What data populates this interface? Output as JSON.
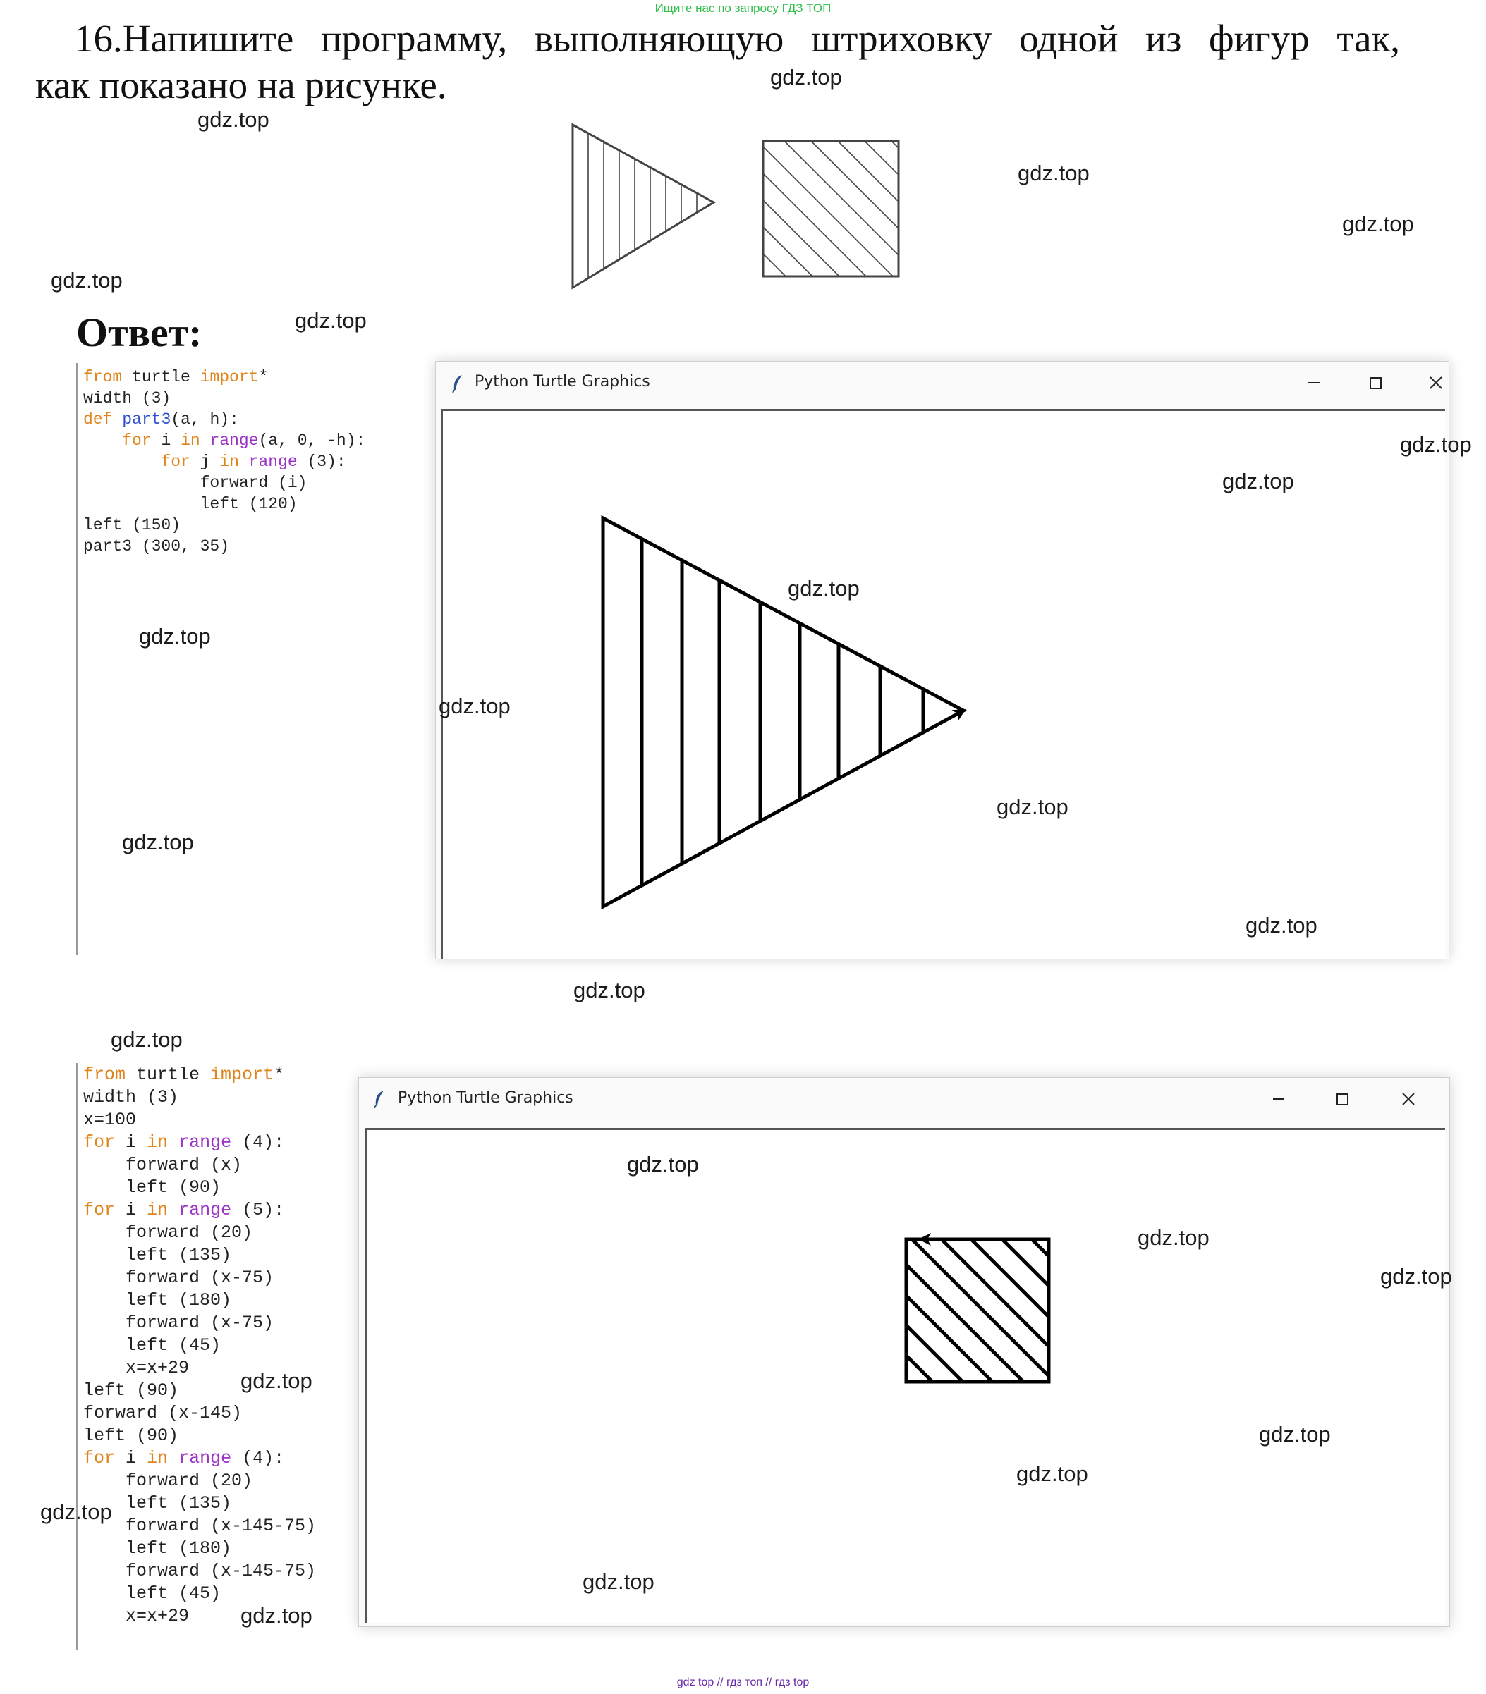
{
  "banner": "Ищите нас по запросу ГДЗ ТОП",
  "task": {
    "line1": "16.Напишите программу, выполняющую штриховку одной из фигур так,",
    "line2": "как показано на рисунке."
  },
  "answer_label": "Ответ:",
  "watermark": "gdz.top",
  "footer": "gdz top  //  гдз топ  //  гдз top",
  "window1": {
    "title": "Python Turtle Graphics",
    "code": [
      [
        [
          "kw",
          "from"
        ],
        [
          "t",
          " turtle "
        ],
        [
          "kw",
          "import"
        ],
        [
          "t",
          "*"
        ]
      ],
      [
        [
          "t",
          "width (3)"
        ]
      ],
      [
        [
          "kw",
          "def"
        ],
        [
          "t",
          " "
        ],
        [
          "fn",
          "part3"
        ],
        [
          "t",
          "(a, h):"
        ]
      ],
      [
        [
          "t",
          "    "
        ],
        [
          "kw",
          "for"
        ],
        [
          "t",
          " i "
        ],
        [
          "kw",
          "in"
        ],
        [
          "t",
          " "
        ],
        [
          "bi",
          "range"
        ],
        [
          "t",
          "(a, 0, -h):"
        ]
      ],
      [
        [
          "t",
          "        "
        ],
        [
          "kw",
          "for"
        ],
        [
          "t",
          " j "
        ],
        [
          "kw",
          "in"
        ],
        [
          "t",
          " "
        ],
        [
          "bi",
          "range"
        ],
        [
          "t",
          " (3):"
        ]
      ],
      [
        [
          "t",
          "            forward (i)"
        ]
      ],
      [
        [
          "t",
          "            left (120)"
        ]
      ],
      [
        [
          "t",
          "left (150)"
        ]
      ],
      [
        [
          "t",
          "part3 (300, 35)"
        ]
      ]
    ]
  },
  "window2": {
    "title": "Python Turtle Graphics",
    "code": [
      [
        [
          "kw",
          "from"
        ],
        [
          "t",
          " turtle "
        ],
        [
          "kw",
          "import"
        ],
        [
          "t",
          "*"
        ]
      ],
      [
        [
          "t",
          "width (3)"
        ]
      ],
      [
        [
          "t",
          "x=100"
        ]
      ],
      [
        [
          "kw",
          "for"
        ],
        [
          "t",
          " i "
        ],
        [
          "kw",
          "in"
        ],
        [
          "t",
          " "
        ],
        [
          "bi",
          "range"
        ],
        [
          "t",
          " (4):"
        ]
      ],
      [
        [
          "t",
          "    forward (x)"
        ]
      ],
      [
        [
          "t",
          "    left (90)"
        ]
      ],
      [
        [
          "kw",
          "for"
        ],
        [
          "t",
          " i "
        ],
        [
          "kw",
          "in"
        ],
        [
          "t",
          " "
        ],
        [
          "bi",
          "range"
        ],
        [
          "t",
          " (5):"
        ]
      ],
      [
        [
          "t",
          "    forward (20)"
        ]
      ],
      [
        [
          "t",
          "    left (135)"
        ]
      ],
      [
        [
          "t",
          "    forward (x-75)"
        ]
      ],
      [
        [
          "t",
          "    left (180)"
        ]
      ],
      [
        [
          "t",
          "    forward (x-75)"
        ]
      ],
      [
        [
          "t",
          "    left (45)"
        ]
      ],
      [
        [
          "t",
          "    x=x+29"
        ]
      ],
      [
        [
          "t",
          "left (90)"
        ]
      ],
      [
        [
          "t",
          "forward (x-145)"
        ]
      ],
      [
        [
          "t",
          "left (90)"
        ]
      ],
      [
        [
          "kw",
          "for"
        ],
        [
          "t",
          " i "
        ],
        [
          "kw",
          "in"
        ],
        [
          "t",
          " "
        ],
        [
          "bi",
          "range"
        ],
        [
          "t",
          " (4):"
        ]
      ],
      [
        [
          "t",
          "    forward (20)"
        ]
      ],
      [
        [
          "t",
          "    left (135)"
        ]
      ],
      [
        [
          "t",
          "    forward (x-145-75)"
        ]
      ],
      [
        [
          "t",
          "    left (180)"
        ]
      ],
      [
        [
          "t",
          "    forward (x-145-75)"
        ]
      ],
      [
        [
          "t",
          "    left (45)"
        ]
      ],
      [
        [
          "t",
          "    x=x+29"
        ]
      ]
    ]
  },
  "colors": {
    "keyword": "#e0841a",
    "builtin": "#9a33c6",
    "function": "#2d4fd0",
    "banner": "#2fbf4a",
    "footer": "#6a2aa8"
  }
}
